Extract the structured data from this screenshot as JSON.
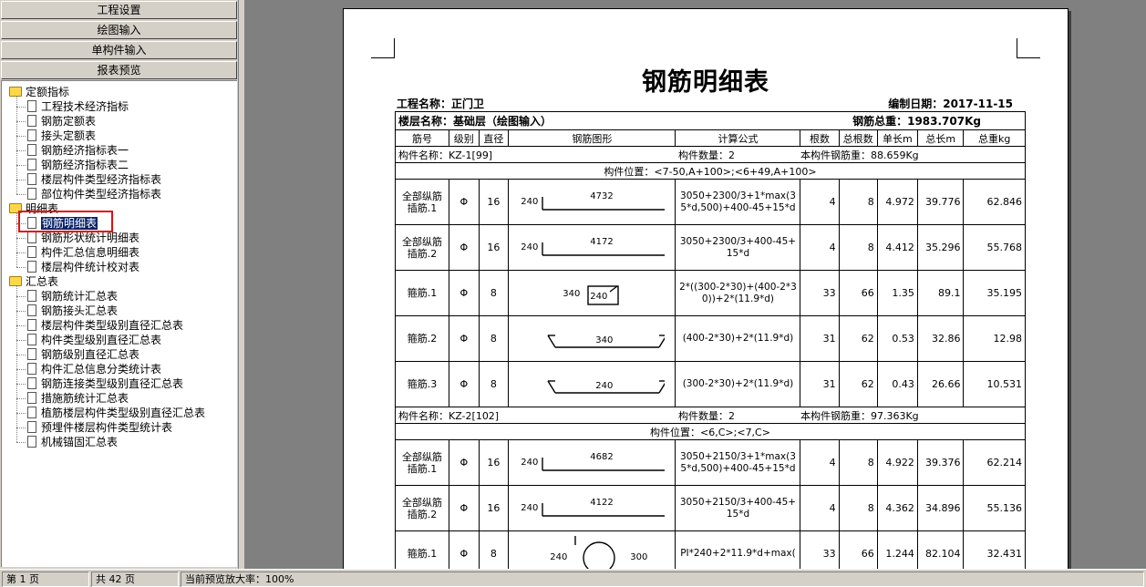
{
  "nav": {
    "project_settings": "工程设置",
    "drawing_input": "绘图输入",
    "single_component_input": "单构件输入",
    "report_preview": "报表预览"
  },
  "tree": {
    "groups": [
      {
        "label": "定额指标",
        "items": [
          "工程技术经济指标",
          "钢筋定额表",
          "接头定额表",
          "钢筋经济指标表一",
          "钢筋经济指标表二",
          "楼层构件类型经济指标表",
          "部位构件类型经济指标表"
        ]
      },
      {
        "label": "明细表",
        "items": [
          "钢筋明细表",
          "钢筋形状统计明细表",
          "构件汇总信息明细表",
          "楼层构件统计校对表"
        ]
      },
      {
        "label": "汇总表",
        "items": [
          "钢筋统计汇总表",
          "钢筋接头汇总表",
          "楼层构件类型级别直径汇总表",
          "构件类型级别直径汇总表",
          "钢筋级别直径汇总表",
          "构件汇总信息分类统计表",
          "钢筋连接类型级别直径汇总表",
          "措施筋统计汇总表",
          "植筋楼层构件类型级别直径汇总表",
          "预埋件楼层构件类型统计表",
          "机械锚固汇总表"
        ]
      }
    ],
    "selected": "钢筋明细表"
  },
  "report": {
    "title": "钢筋明细表",
    "project_name": "工程名称：正门卫",
    "date": "编制日期：2017-11-15",
    "floor_name": "楼层名称：基础层（绘图输入）",
    "total_weight": "钢筋总重：1983.707Kg",
    "headers": [
      "筋号",
      "级别",
      "直径",
      "钢筋图形",
      "计算公式",
      "根数",
      "总根数",
      "单长m",
      "总长m",
      "总重kg"
    ],
    "components": [
      {
        "name": "构件名称：KZ-1[99]",
        "count": "构件数量：2",
        "weight": "本构件钢筋重：88.659Kg",
        "position": "构件位置：<7-50,A+100>;<6+49,A+100>",
        "rows": [
          {
            "name": "全部纵筋插筋.1",
            "grade": "Φ",
            "dia": "16",
            "shape": "L",
            "s1": "240",
            "s2": "4732",
            "formula": "3050+2300/3+1*max(35*d,500)+400-45+15*d",
            "n": "4",
            "total_n": "8",
            "unit_len": "4.972",
            "total_len": "39.776",
            "weight": "62.846"
          },
          {
            "name": "全部纵筋插筋.2",
            "grade": "Φ",
            "dia": "16",
            "shape": "L",
            "s1": "240",
            "s2": "4172",
            "formula": "3050+2300/3+400-45+15*d",
            "n": "4",
            "total_n": "8",
            "unit_len": "4.412",
            "total_len": "35.296",
            "weight": "55.768"
          },
          {
            "name": "箍筋.1",
            "grade": "Φ",
            "dia": "8",
            "shape": "box",
            "s1": "340",
            "s2": "240",
            "formula": "2*((300-2*30)+(400-2*30))+2*(11.9*d)",
            "n": "33",
            "total_n": "66",
            "unit_len": "1.35",
            "total_len": "89.1",
            "weight": "35.195"
          },
          {
            "name": "箍筋.2",
            "grade": "Φ",
            "dia": "8",
            "shape": "tie",
            "s1": "",
            "s2": "340",
            "formula": "(400-2*30)+2*(11.9*d)",
            "n": "31",
            "total_n": "62",
            "unit_len": "0.53",
            "total_len": "32.86",
            "weight": "12.98"
          },
          {
            "name": "箍筋.3",
            "grade": "Φ",
            "dia": "8",
            "shape": "tie",
            "s1": "",
            "s2": "240",
            "formula": "(300-2*30)+2*(11.9*d)",
            "n": "31",
            "total_n": "62",
            "unit_len": "0.43",
            "total_len": "26.66",
            "weight": "10.531"
          }
        ]
      },
      {
        "name": "构件名称：KZ-2[102]",
        "count": "构件数量：2",
        "weight": "本构件钢筋重：97.363Kg",
        "position": "构件位置：<6,C>;<7,C>",
        "rows": [
          {
            "name": "全部纵筋插筋.1",
            "grade": "Φ",
            "dia": "16",
            "shape": "L",
            "s1": "240",
            "s2": "4682",
            "formula": "3050+2150/3+1*max(35*d,500)+400-45+15*d",
            "n": "4",
            "total_n": "8",
            "unit_len": "4.922",
            "total_len": "39.376",
            "weight": "62.214"
          },
          {
            "name": "全部纵筋插筋.2",
            "grade": "Φ",
            "dia": "16",
            "shape": "L",
            "s1": "240",
            "s2": "4122",
            "formula": "3050+2150/3+400-45+15*d",
            "n": "4",
            "total_n": "8",
            "unit_len": "4.362",
            "total_len": "34.896",
            "weight": "55.136"
          },
          {
            "name": "箍筋.1",
            "grade": "Φ",
            "dia": "8",
            "shape": "circle",
            "s1": "240",
            "s2": "300",
            "formula": "PI*240+2*11.9*d+max(",
            "n": "33",
            "total_n": "66",
            "unit_len": "1.244",
            "total_len": "82.104",
            "weight": "32.431"
          }
        ]
      }
    ]
  },
  "status": {
    "page": "第 1 页",
    "total_pages": "共 42 页",
    "zoom": "当前预览放大率：100%"
  }
}
